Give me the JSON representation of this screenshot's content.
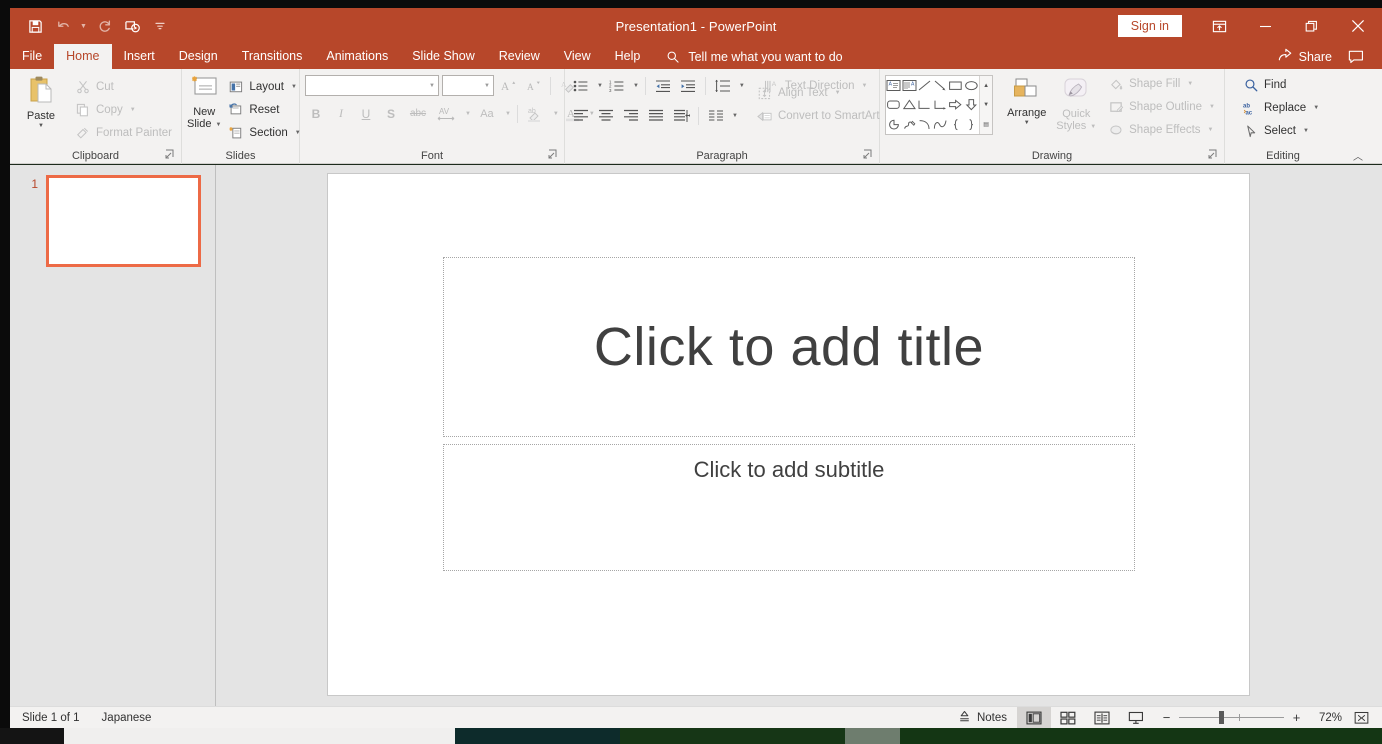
{
  "window": {
    "title": "Presentation1  -  PowerPoint",
    "signin_label": "Sign in",
    "ribbon_display_icon": "ribbon-display-options-icon",
    "minimize_icon": "minimize-icon",
    "restore_icon": "restore-icon",
    "close_icon": "close-icon"
  },
  "quick_access": {
    "items": [
      {
        "name": "save",
        "icon": "save-icon"
      },
      {
        "name": "undo",
        "icon": "undo-icon",
        "caret": true
      },
      {
        "name": "redo",
        "icon": "redo-icon"
      },
      {
        "name": "start-from-beginning",
        "icon": "start-presentation-icon"
      },
      {
        "name": "customize-quick-access-toolbar",
        "icon": "chevron-down-icon"
      }
    ]
  },
  "tabs": [
    {
      "label": "File",
      "active": false
    },
    {
      "label": "Home",
      "active": true
    },
    {
      "label": "Insert",
      "active": false
    },
    {
      "label": "Design",
      "active": false
    },
    {
      "label": "Transitions",
      "active": false
    },
    {
      "label": "Animations",
      "active": false
    },
    {
      "label": "Slide Show",
      "active": false
    },
    {
      "label": "Review",
      "active": false
    },
    {
      "label": "View",
      "active": false
    },
    {
      "label": "Help",
      "active": false
    }
  ],
  "tell_me": {
    "placeholder": "Tell me what you want to do",
    "icon": "search-icon"
  },
  "share": {
    "label": "Share",
    "icon": "share-icon"
  },
  "comments": {
    "icon": "comment-icon"
  },
  "ribbon": {
    "groups": [
      {
        "label": "Clipboard",
        "has_launcher": true,
        "paste": {
          "label": "Paste",
          "icon": "paste-icon",
          "enabled": false
        },
        "items": [
          {
            "label": "Cut",
            "icon": "cut-icon",
            "enabled": false
          },
          {
            "label": "Copy",
            "icon": "copy-icon",
            "enabled": false,
            "caret": true
          },
          {
            "label": "Format Painter",
            "icon": "format-painter-icon",
            "enabled": false
          }
        ]
      },
      {
        "label": "Slides",
        "has_launcher": false,
        "new_slide": {
          "label_line1": "New",
          "label_line2": "Slide",
          "icon": "new-slide-icon"
        },
        "items": [
          {
            "label": "Layout",
            "icon": "layout-icon",
            "caret": true
          },
          {
            "label": "Reset",
            "icon": "reset-icon"
          },
          {
            "label": "Section",
            "icon": "section-icon",
            "caret": true
          }
        ]
      },
      {
        "label": "Font",
        "has_launcher": true,
        "font_name": {
          "value": "",
          "placeholder": ""
        },
        "font_size": {
          "value": "",
          "placeholder": ""
        },
        "buttons": [
          {
            "name": "increase-font-size",
            "glyph": "A",
            "sup": "▲"
          },
          {
            "name": "decrease-font-size",
            "glyph": "A",
            "sup": "▼"
          },
          {
            "name": "clear-all-formatting",
            "glyph": "A"
          },
          {
            "name": "bold",
            "glyph": "B"
          },
          {
            "name": "italic",
            "glyph": "I"
          },
          {
            "name": "underline",
            "glyph": "U"
          },
          {
            "name": "text-shadow",
            "glyph": "S"
          },
          {
            "name": "strikethrough",
            "glyph": "abc"
          },
          {
            "name": "character-spacing",
            "glyph": "AV"
          },
          {
            "name": "change-case",
            "glyph": "Aa"
          },
          {
            "name": "text-highlight-color",
            "glyph": "ab"
          },
          {
            "name": "font-color",
            "glyph": "A"
          }
        ]
      },
      {
        "label": "Paragraph",
        "has_launcher": true,
        "items": [
          {
            "label": "Text Direction",
            "icon": "text-direction-icon",
            "caret": true,
            "enabled": false
          },
          {
            "label": "Align Text",
            "icon": "align-text-icon",
            "caret": true,
            "enabled": false
          },
          {
            "label": "Convert to SmartArt",
            "icon": "smartart-icon",
            "caret": true,
            "enabled": false
          }
        ],
        "buttons_row1": [
          "bullets-icon",
          "numbering-icon",
          "decrease-indent-icon",
          "increase-indent-icon",
          "line-spacing-icon"
        ],
        "buttons_row2": [
          "align-left-icon",
          "align-center-icon",
          "align-right-icon",
          "justify-icon",
          "text-direction-col-icon",
          "columns-icon"
        ]
      },
      {
        "label": "Drawing",
        "has_launcher": true,
        "shapes": [
          "textbox-shape",
          "vertical-textbox-shape",
          "line-shape",
          "arrow-shape",
          "rectangle-shape",
          "oval-shape",
          "rounded-rectangle-shape",
          "triangle-shape",
          "elbow-connector-shape",
          "elbow-arrow-connector-shape",
          "right-arrow-shape",
          "down-arrow-shape",
          "pie-shape",
          "freeform-shape",
          "arc-shape",
          "wave-shape",
          "left-brace-shape",
          "right-brace-shape"
        ],
        "arrange": {
          "label": "Arrange",
          "icon": "arrange-icon"
        },
        "quick_styles": {
          "label_line1": "Quick",
          "label_line2": "Styles",
          "icon": "quick-styles-icon",
          "enabled": false
        },
        "items": [
          {
            "label": "Shape Fill",
            "icon": "shape-fill-icon",
            "caret": true,
            "enabled": false
          },
          {
            "label": "Shape Outline",
            "icon": "shape-outline-icon",
            "caret": true,
            "enabled": false
          },
          {
            "label": "Shape Effects",
            "icon": "shape-effects-icon",
            "caret": true,
            "enabled": false
          }
        ]
      },
      {
        "label": "Editing",
        "has_launcher": false,
        "items": [
          {
            "label": "Find",
            "icon": "find-icon"
          },
          {
            "label": "Replace",
            "icon": "replace-icon",
            "caret": true
          },
          {
            "label": "Select",
            "icon": "select-icon",
            "caret": true
          }
        ],
        "collapse_icon": "chevron-up-icon"
      }
    ]
  },
  "thumbnails": [
    {
      "number": "1",
      "selected": true
    }
  ],
  "slide": {
    "title_placeholder": "Click to add title",
    "subtitle_placeholder": "Click to add subtitle"
  },
  "status": {
    "slide_count": "Slide 1 of 1",
    "language": "Japanese",
    "notes_label": "Notes",
    "notes_icon": "notes-icon",
    "views": [
      {
        "name": "normal-view",
        "icon": "normal-view-icon",
        "selected": true
      },
      {
        "name": "slide-sorter-view",
        "icon": "slide-sorter-icon",
        "selected": false
      },
      {
        "name": "reading-view",
        "icon": "reading-view-icon",
        "selected": false
      },
      {
        "name": "slide-show-view",
        "icon": "slide-show-icon",
        "selected": false
      }
    ],
    "zoom_out": "−",
    "zoom_in": "+",
    "zoom_level": "72%",
    "fit_icon": "fit-slide-to-window-icon"
  },
  "colors": {
    "accent": "#b7472a",
    "ribbon_bg": "#f3f2f1",
    "workspace_bg": "#e4e4e4",
    "thumb_selected_border": "#ed6a46"
  }
}
